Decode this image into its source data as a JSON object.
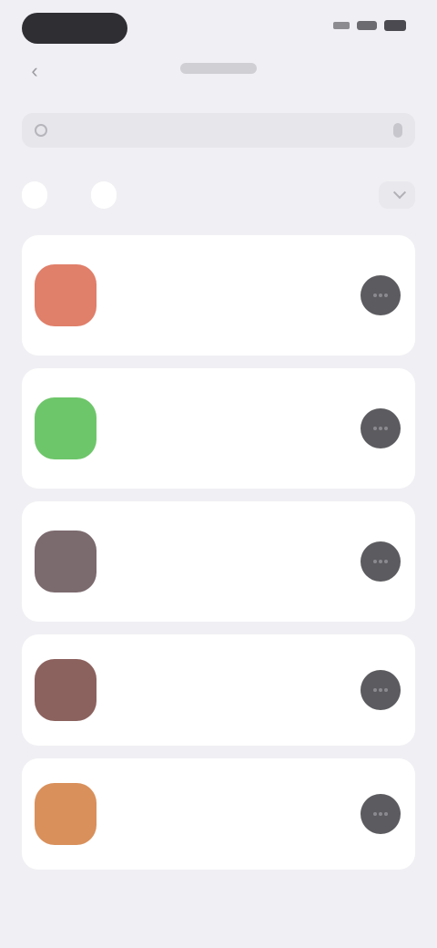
{
  "status_bar": {
    "time": "",
    "icons": [
      "signal-icon",
      "wifi-icon",
      "battery-icon"
    ]
  },
  "nav": {
    "back_icon": "chevron-left-icon",
    "title": ""
  },
  "search": {
    "placeholder": "",
    "value": "",
    "icon": "search-icon",
    "mic_icon": "mic-icon"
  },
  "filters": {
    "chips": [
      {
        "label": "",
        "active": true
      },
      {
        "label": "",
        "active": false
      },
      {
        "label": "",
        "active": false
      }
    ],
    "sort_label": ""
  },
  "list": {
    "items": [
      {
        "title": "",
        "meta": "",
        "avatar_color": "#e07f6a"
      },
      {
        "title": "",
        "meta": "",
        "avatar_color": "#6ec66a"
      },
      {
        "title": "",
        "meta": "",
        "avatar_color": "#7b6a6e"
      },
      {
        "title": "",
        "meta": "",
        "avatar_color": "#8c625e"
      },
      {
        "title": "",
        "meta": "",
        "avatar_color": "#d9905b"
      }
    ]
  },
  "colors": {
    "background": "#f0f0f4",
    "card": "#ffffff",
    "action": "#5c5c60",
    "status_pill": "#2f2f33"
  }
}
